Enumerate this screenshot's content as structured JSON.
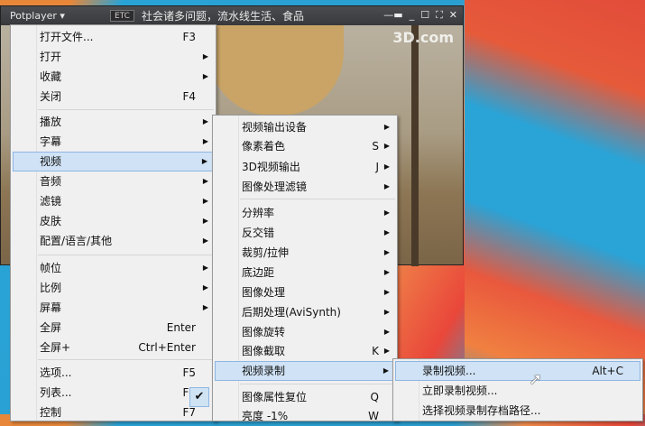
{
  "player": {
    "brand": "Potplayer ▾",
    "etc": "ETC",
    "title": "社会诸多问题，流水线生活、食品",
    "logo": "3D.com",
    "controls": [
      "—▬",
      "_",
      "☐",
      "⛶",
      "✕"
    ]
  },
  "main_menu": [
    {
      "label": "打开文件...",
      "shortcut": "F3"
    },
    {
      "label": "打开",
      "sub": true
    },
    {
      "label": "收藏",
      "sub": true
    },
    {
      "label": "关闭",
      "shortcut": "F4"
    },
    {
      "label": "播放",
      "sub": true
    },
    {
      "label": "字幕",
      "sub": true
    },
    {
      "label": "视频",
      "sub": true
    },
    {
      "label": "音频",
      "sub": true
    },
    {
      "label": "滤镜",
      "sub": true
    },
    {
      "label": "皮肤",
      "sub": true
    },
    {
      "label": "配置/语言/其他",
      "sub": true
    },
    {
      "label": "帧位",
      "sub": true
    },
    {
      "label": "比例",
      "sub": true
    },
    {
      "label": "屏幕",
      "sub": true
    },
    {
      "label": "全屏",
      "shortcut": "Enter"
    },
    {
      "label": "全屏+",
      "shortcut": "Ctrl+Enter"
    },
    {
      "label": "选项...",
      "shortcut": "F5"
    },
    {
      "label": "列表...",
      "shortcut": "F6"
    },
    {
      "label": "控制",
      "shortcut": "F7"
    }
  ],
  "video_menu": [
    {
      "label": "视频输出设备",
      "shortcut": ""
    },
    {
      "label": "像素着色",
      "shortcut": "S"
    },
    {
      "label": "3D视频输出",
      "shortcut": "J"
    },
    {
      "label": "图像处理滤镜",
      "shortcut": ""
    },
    {
      "label": "分辨率",
      "shortcut": ""
    },
    {
      "label": "反交错",
      "shortcut": ""
    },
    {
      "label": "裁剪/拉伸",
      "shortcut": ""
    },
    {
      "label": "底边距",
      "shortcut": ""
    },
    {
      "label": "图像处理",
      "shortcut": ""
    },
    {
      "label": "后期处理(AviSynth)",
      "shortcut": ""
    },
    {
      "label": "图像旋转",
      "shortcut": ""
    },
    {
      "label": "图像截取",
      "shortcut": "K"
    },
    {
      "label": "视频录制",
      "shortcut": ""
    },
    {
      "label": "图像属性复位",
      "shortcut": "Q"
    },
    {
      "label": "亮度 -1%",
      "shortcut": "W"
    }
  ],
  "record_menu": [
    {
      "label": "录制视频...",
      "shortcut": "Alt+C"
    },
    {
      "label": "立即录制视频...",
      "shortcut": ""
    },
    {
      "label": "选择视频录制存档路径...",
      "shortcut": ""
    }
  ]
}
